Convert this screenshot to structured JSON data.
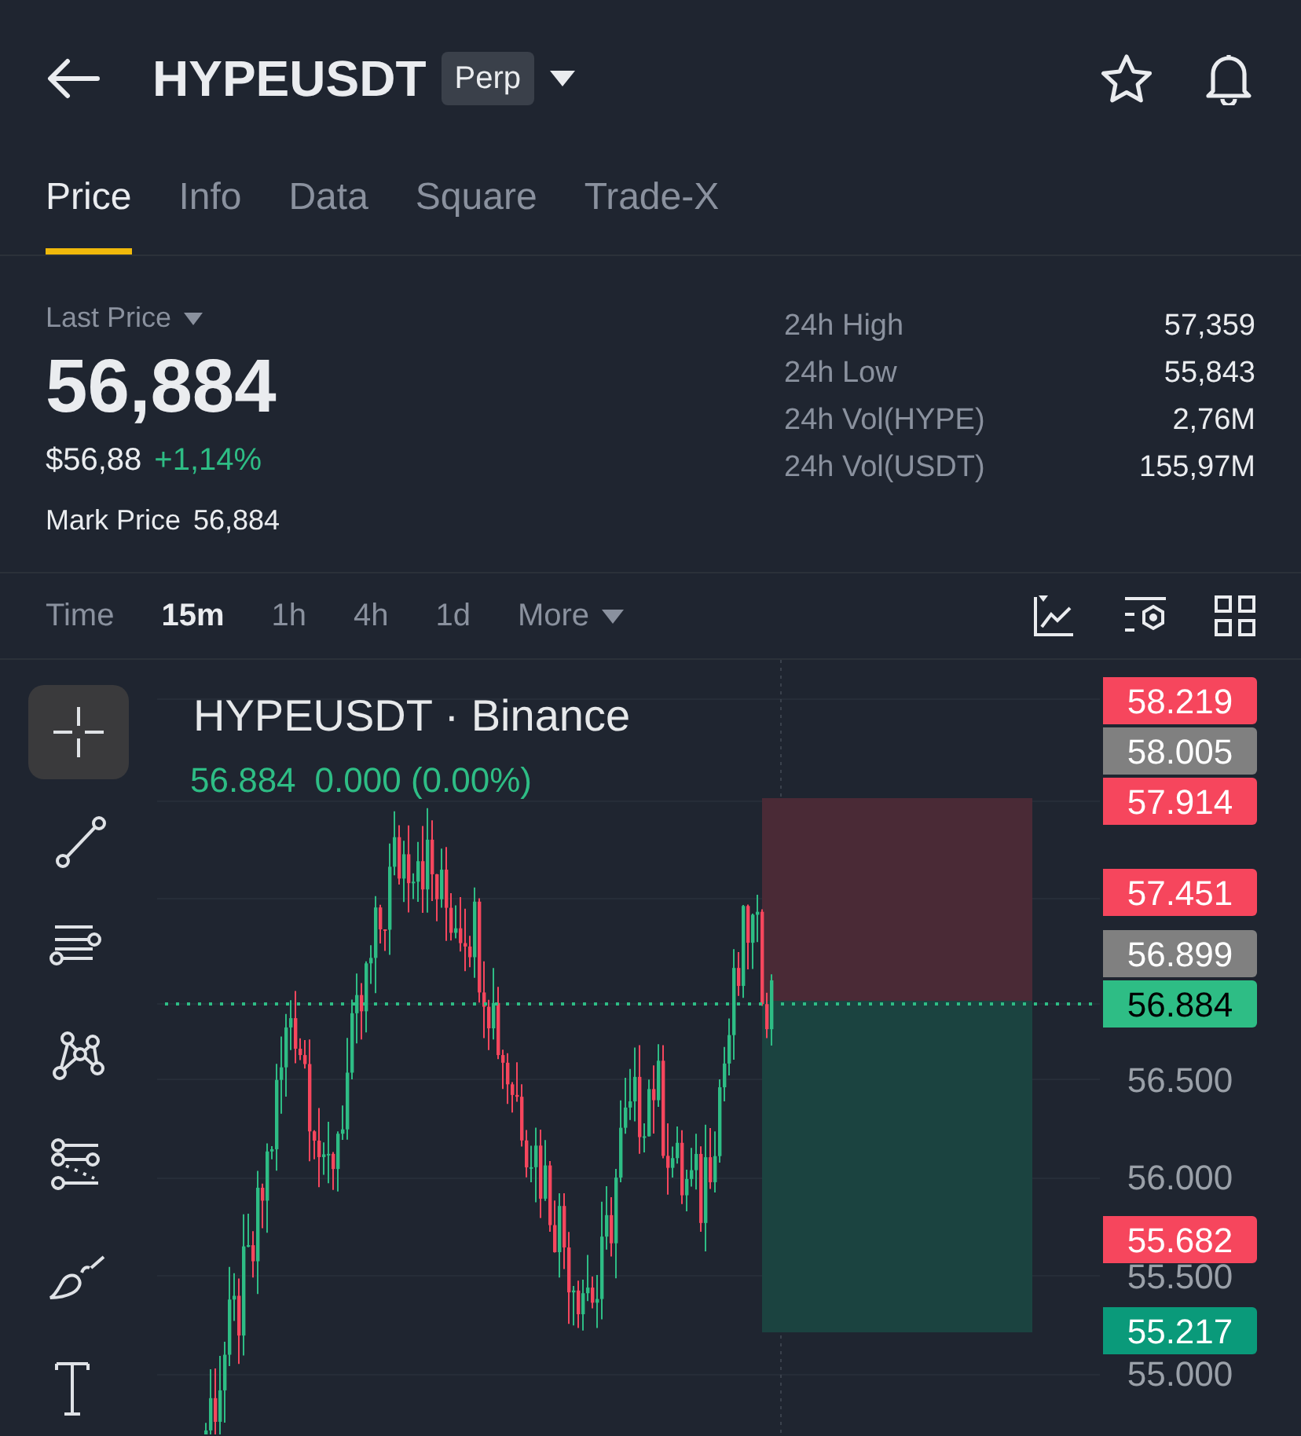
{
  "header": {
    "symbol": "HYPEUSDT",
    "badge": "Perp"
  },
  "tabs": [
    {
      "label": "Price",
      "selected": true
    },
    {
      "label": "Info",
      "selected": false
    },
    {
      "label": "Data",
      "selected": false
    },
    {
      "label": "Square",
      "selected": false
    },
    {
      "label": "Trade-X",
      "selected": false
    }
  ],
  "ticker": {
    "last_price_label": "Last Price",
    "last_price": "56,884",
    "usd_price": "$56,88",
    "change": "+1,14%",
    "mark_price_label": "Mark Price",
    "mark_price": "56,884"
  },
  "stats": [
    {
      "label": "24h High",
      "value": "57,359"
    },
    {
      "label": "24h Low",
      "value": "55,843"
    },
    {
      "label": "24h Vol(HYPE)",
      "value": "2,76M"
    },
    {
      "label": "24h Vol(USDT)",
      "value": "155,97M"
    }
  ],
  "intervals": [
    {
      "label": "Time",
      "selected": false
    },
    {
      "label": "15m",
      "selected": true
    },
    {
      "label": "1h",
      "selected": false
    },
    {
      "label": "4h",
      "selected": false
    },
    {
      "label": "1d",
      "selected": false
    },
    {
      "label": "More",
      "selected": false
    }
  ],
  "drawing_tools": [
    {
      "kind": "crosshair",
      "selected": true
    },
    {
      "kind": "line",
      "selected": false
    },
    {
      "kind": "parallel",
      "selected": false
    },
    {
      "kind": "pattern",
      "selected": false
    },
    {
      "kind": "fib",
      "selected": false
    },
    {
      "kind": "brush",
      "selected": false
    },
    {
      "kind": "text",
      "selected": false
    }
  ],
  "chart": {
    "title": "HYPEUSDT · Binance",
    "last_value": "56.884",
    "last_change": "0.000 (0.00%)",
    "price_labels": [
      {
        "text": "58.219",
        "kind": "red"
      },
      {
        "text": "58.005",
        "kind": "gray"
      },
      {
        "text": "57.914",
        "kind": "red"
      },
      {
        "text": "57.451",
        "kind": "red"
      },
      {
        "text": "56.899",
        "kind": "gray"
      },
      {
        "text": "56.884",
        "kind": "current"
      },
      {
        "text": "56.500",
        "kind": "axis"
      },
      {
        "text": "56.000",
        "kind": "axis"
      },
      {
        "text": "55.682",
        "kind": "red"
      },
      {
        "text": "55.500",
        "kind": "axis"
      },
      {
        "text": "55.217",
        "kind": "teal"
      },
      {
        "text": "55.000",
        "kind": "axis"
      }
    ]
  }
}
